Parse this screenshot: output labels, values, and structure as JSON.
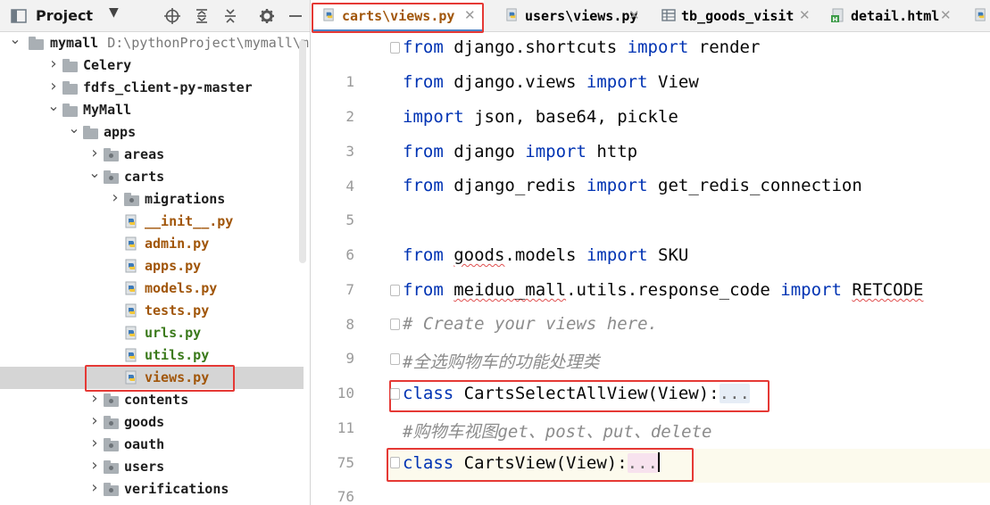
{
  "project": {
    "title": "Project",
    "icons": [
      "crosshair-icon",
      "expand-all-icon",
      "collapse-all-icon",
      "gear-icon",
      "minimize-icon"
    ]
  },
  "tree": [
    {
      "label": "mymall",
      "path": "D:\\pythonProject\\mymall\\m",
      "type": "folder",
      "expanded": true,
      "indent": 0
    },
    {
      "label": "Celery",
      "type": "folder",
      "expanded": false,
      "indent": 1
    },
    {
      "label": "fdfs_client-py-master",
      "type": "folder",
      "expanded": false,
      "indent": 1
    },
    {
      "label": "MyMall",
      "type": "folder",
      "expanded": true,
      "indent": 1
    },
    {
      "label": "apps",
      "type": "folder",
      "expanded": true,
      "indent": 2
    },
    {
      "label": "areas",
      "type": "package",
      "expanded": false,
      "indent": 3
    },
    {
      "label": "carts",
      "type": "package",
      "expanded": true,
      "indent": 3
    },
    {
      "label": "migrations",
      "type": "package",
      "expanded": false,
      "indent": 4
    },
    {
      "label": "__init__.py",
      "type": "file",
      "status": "modified",
      "indent": 4
    },
    {
      "label": "admin.py",
      "type": "file",
      "status": "modified",
      "indent": 4
    },
    {
      "label": "apps.py",
      "type": "file",
      "status": "modified",
      "indent": 4
    },
    {
      "label": "models.py",
      "type": "file",
      "status": "modified",
      "indent": 4
    },
    {
      "label": "tests.py",
      "type": "file",
      "status": "modified",
      "indent": 4
    },
    {
      "label": "urls.py",
      "type": "file",
      "status": "added",
      "indent": 4
    },
    {
      "label": "utils.py",
      "type": "file",
      "status": "added",
      "indent": 4
    },
    {
      "label": "views.py",
      "type": "file",
      "status": "modified",
      "indent": 4,
      "selected": true
    },
    {
      "label": "contents",
      "type": "package",
      "expanded": false,
      "indent": 3
    },
    {
      "label": "goods",
      "type": "package",
      "expanded": false,
      "indent": 3
    },
    {
      "label": "oauth",
      "type": "package",
      "expanded": false,
      "indent": 3
    },
    {
      "label": "users",
      "type": "package",
      "expanded": false,
      "indent": 3
    },
    {
      "label": "verifications",
      "type": "package",
      "expanded": false,
      "indent": 3
    }
  ],
  "tabs": [
    {
      "label": "carts\\views.py",
      "icon": "python-file-icon",
      "active": true,
      "closable": true
    },
    {
      "label": "users\\views.py",
      "icon": "python-file-icon",
      "active": false,
      "closable": true
    },
    {
      "label": "tb_goods_visit",
      "icon": "table-icon",
      "active": false,
      "closable": true
    },
    {
      "label": "detail.html",
      "icon": "html-file-icon",
      "active": false,
      "closable": true
    },
    {
      "label": "",
      "icon": "python-file-icon",
      "active": false,
      "closable": false
    }
  ],
  "code": [
    {
      "line": "1",
      "fold": true,
      "tokens": [
        {
          "t": "from",
          "c": "kw"
        },
        {
          "t": " django.shortcuts "
        },
        {
          "t": "import",
          "c": "kw"
        },
        {
          "t": " render"
        }
      ]
    },
    {
      "line": "2",
      "tokens": [
        {
          "t": "from",
          "c": "kw"
        },
        {
          "t": " django.views "
        },
        {
          "t": "import",
          "c": "kw"
        },
        {
          "t": " View"
        }
      ]
    },
    {
      "line": "3",
      "tokens": [
        {
          "t": "import",
          "c": "kw"
        },
        {
          "t": " json, base64, pickle"
        }
      ]
    },
    {
      "line": "4",
      "tokens": [
        {
          "t": "from",
          "c": "kw"
        },
        {
          "t": " django "
        },
        {
          "t": "import",
          "c": "kw"
        },
        {
          "t": " http"
        }
      ]
    },
    {
      "line": "5",
      "tokens": [
        {
          "t": "from",
          "c": "kw"
        },
        {
          "t": " django_redis "
        },
        {
          "t": "import",
          "c": "kw"
        },
        {
          "t": " get_redis_connection"
        }
      ]
    },
    {
      "line": "6",
      "tokens": []
    },
    {
      "line": "7",
      "tokens": [
        {
          "t": "from",
          "c": "kw"
        },
        {
          "t": " "
        },
        {
          "t": "goods",
          "c": "squig"
        },
        {
          "t": ".models "
        },
        {
          "t": "import",
          "c": "kw"
        },
        {
          "t": " SKU"
        }
      ]
    },
    {
      "line": "8",
      "fold": true,
      "tokens": [
        {
          "t": "from",
          "c": "kw"
        },
        {
          "t": " "
        },
        {
          "t": "meiduo_mall",
          "c": "squig"
        },
        {
          "t": ".utils.response_code "
        },
        {
          "t": "import",
          "c": "kw"
        },
        {
          "t": " "
        },
        {
          "t": "RETCODE",
          "c": "squig"
        }
      ]
    },
    {
      "line": "9",
      "fold": true,
      "tokens": [
        {
          "t": "# Create your views here.",
          "c": "cm"
        }
      ]
    },
    {
      "line": "10",
      "fold": true,
      "tokens": [
        {
          "t": "#全选购物车的功能处理类",
          "c": "cm"
        }
      ]
    },
    {
      "line": "11",
      "fold": true,
      "tokens": [
        {
          "t": "class",
          "c": "kw"
        },
        {
          "t": " CartsSelectAllView(View):"
        },
        {
          "t": "...",
          "c": "folded"
        }
      ]
    },
    {
      "line": "75",
      "tokens": [
        {
          "t": "#购物车视图get、post、put、delete",
          "c": "cm"
        }
      ]
    },
    {
      "line": "76",
      "fold": true,
      "current": true,
      "tokens": [
        {
          "t": "class",
          "c": "kw"
        },
        {
          "t": " CartsView(View):"
        },
        {
          "t": "...",
          "c": "folded pink"
        },
        {
          "t": "",
          "c": "caret"
        }
      ]
    }
  ],
  "colors": {
    "keyword": "#0033b3",
    "comment": "#8c8c8c",
    "modified": "#a1560a",
    "added": "#3b7a1c",
    "highlight": "#e53935",
    "tab_underline": "#4a86c8"
  }
}
